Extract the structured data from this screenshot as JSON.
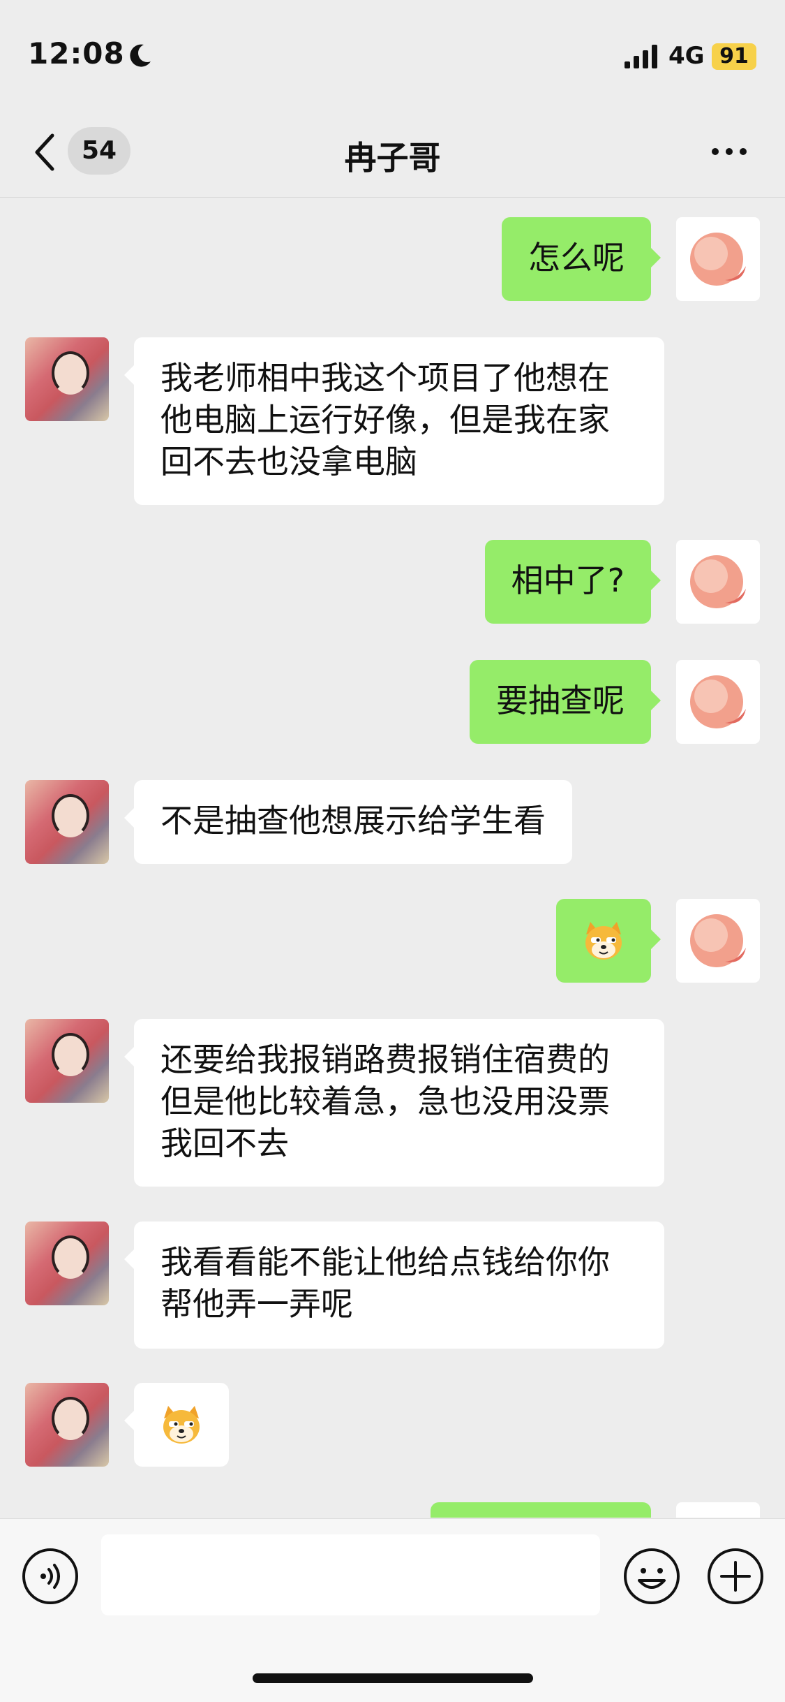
{
  "status_bar": {
    "time": "12:08",
    "network": "4G",
    "battery": "91"
  },
  "header": {
    "unread_count": "54",
    "title": "冉子哥"
  },
  "messages": [
    {
      "side": "out",
      "text": "怎么呢"
    },
    {
      "side": "in",
      "text": "我老师相中我这个项目了他想在他电脑上运行好像，但是我在家回不去也没拿电脑"
    },
    {
      "side": "out",
      "text": "相中了?"
    },
    {
      "side": "out",
      "text": "要抽查呢"
    },
    {
      "side": "in",
      "text": "不是抽查他想展示给学生看"
    },
    {
      "side": "out",
      "emoji": "doge-face"
    },
    {
      "side": "in",
      "text": "还要给我报销路费报销住宿费的但是他比较着急，急也没用没票我回不去"
    },
    {
      "side": "in",
      "text": "我看看能不能让他给点钱给你你帮他弄一弄呢"
    },
    {
      "side": "in",
      "emoji": "doge-face"
    },
    {
      "side": "out",
      "text": ""
    }
  ],
  "input": {
    "value": ""
  },
  "colors": {
    "outgoing_bubble": "#95ec69",
    "incoming_bubble": "#ffffff",
    "background": "#ededed"
  }
}
